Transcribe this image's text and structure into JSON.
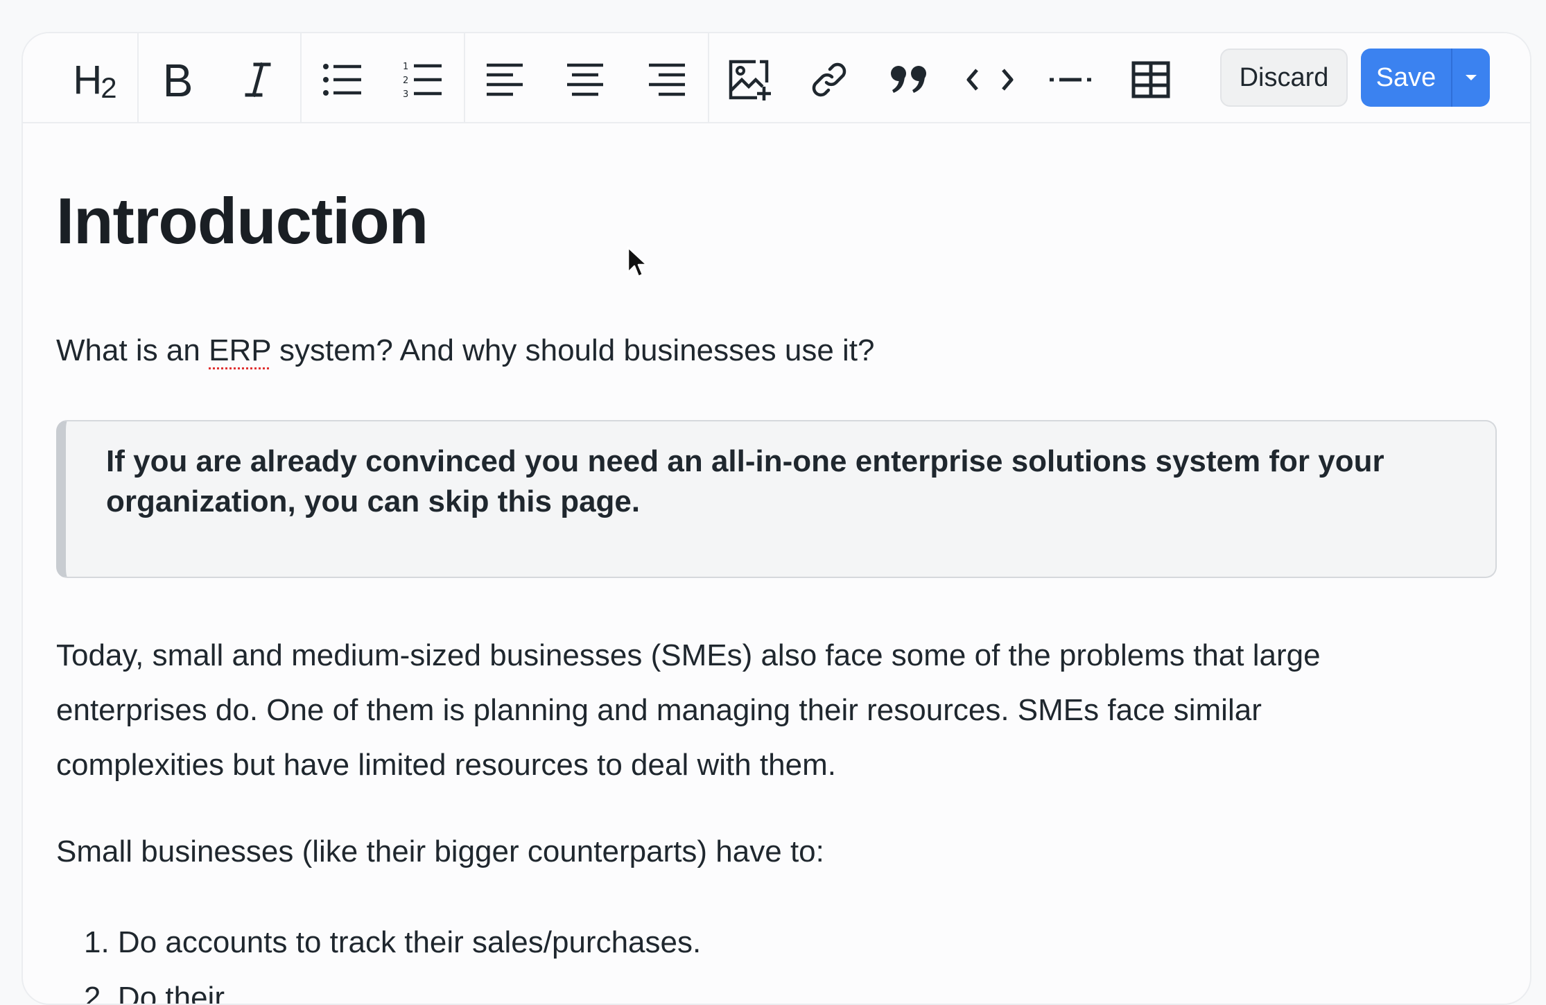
{
  "toolbar": {
    "heading_label": "H",
    "heading_sub": "2",
    "bold_icon": "bold-icon",
    "italic_icon": "italic-icon",
    "discard_label": "Discard",
    "save_label": "Save"
  },
  "document": {
    "title": "Introduction",
    "intro_prefix": "What is an ",
    "intro_erp": "ERP",
    "intro_suffix": " system? And why should businesses use it?",
    "callout_line1": "If you are already convinced you need an all-in-one enterprise solutions system for your",
    "callout_line2": "organization, you can skip this page.",
    "body_line1": "Today, small and medium-sized businesses (SMEs) also face some of the problems that large",
    "body_line2": "enterprises do. One of them is planning and managing their resources. SMEs face similar",
    "body_line3": "complexities but have limited resources to deal with them.",
    "small_business": "Small businesses (like their bigger counterparts) have to:",
    "list_item_1": "1. Do accounts to track their sales/purchases.",
    "list_item_2_partial": "2. Do their"
  },
  "colors": {
    "accent": "#3b82f0",
    "text": "#1f272e",
    "spellcheck": "#e03131"
  }
}
